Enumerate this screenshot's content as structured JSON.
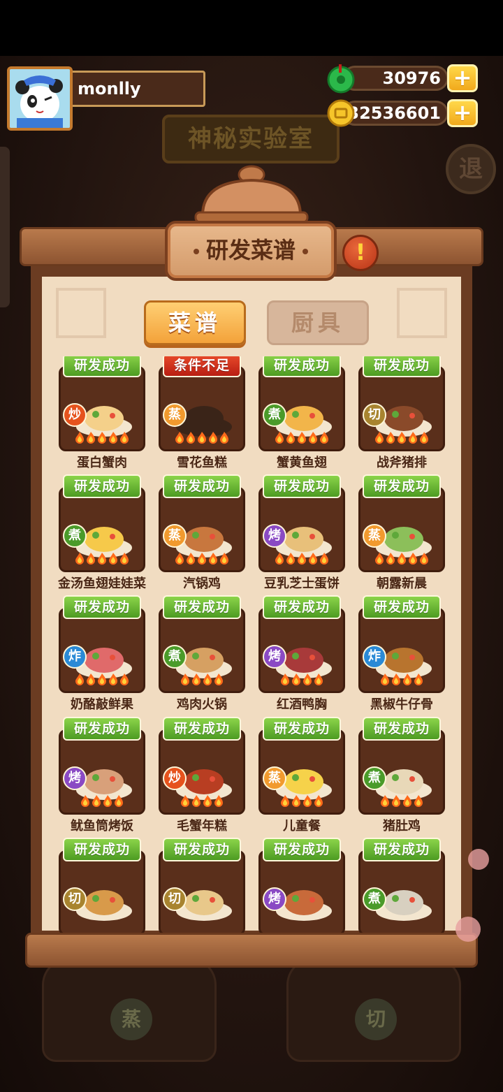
{
  "player": {
    "name": "monlly",
    "jade": "30976",
    "coins": "32536601",
    "plus": "+"
  },
  "background": {
    "lab_title": "神秘实验室",
    "exit_label": "退",
    "stove_left_label": "蒸",
    "stove_right_label": "切"
  },
  "panel": {
    "title": "研发菜谱",
    "warn_label": "!",
    "tabs": [
      {
        "label": "菜谱",
        "active": true
      },
      {
        "label": "厨具",
        "active": false
      }
    ]
  },
  "recipes": [
    {
      "name": "蛋白蟹肉",
      "status": "研发成功",
      "ok": true,
      "method": "炒",
      "flames": 5,
      "dish_color": "#f4d08a"
    },
    {
      "name": "雪花鱼糕",
      "status": "条件不足",
      "ok": false,
      "method": "蒸",
      "flames": 5,
      "dish_color": "#3a2418"
    },
    {
      "name": "蟹黄鱼翅",
      "status": "研发成功",
      "ok": true,
      "method": "煮",
      "flames": 5,
      "dish_color": "#f2b54a"
    },
    {
      "name": "战斧猪排",
      "status": "研发成功",
      "ok": true,
      "method": "切",
      "flames": 5,
      "dish_color": "#8a4a2a"
    },
    {
      "name": "金汤鱼翅娃娃菜",
      "status": "研发成功",
      "ok": true,
      "method": "煮",
      "flames": 5,
      "dish_color": "#f6c94a"
    },
    {
      "name": "汽锅鸡",
      "status": "研发成功",
      "ok": true,
      "method": "蒸",
      "flames": 5,
      "dish_color": "#c8773e"
    },
    {
      "name": "豆乳芝士蛋饼",
      "status": "研发成功",
      "ok": true,
      "method": "烤",
      "flames": 5,
      "dish_color": "#e8c07a"
    },
    {
      "name": "朝露新晨",
      "status": "研发成功",
      "ok": true,
      "method": "蒸",
      "flames": 5,
      "dish_color": "#8cbf5a"
    },
    {
      "name": "奶酪敲鲜果",
      "status": "研发成功",
      "ok": true,
      "method": "炸",
      "flames": 5,
      "dish_color": "#e06a6a"
    },
    {
      "name": "鸡肉火锅",
      "status": "研发成功",
      "ok": true,
      "method": "煮",
      "flames": 4,
      "dish_color": "#d6a062"
    },
    {
      "name": "红酒鸭胸",
      "status": "研发成功",
      "ok": true,
      "method": "烤",
      "flames": 4,
      "dish_color": "#a83a3a"
    },
    {
      "name": "黑椒牛仔骨",
      "status": "研发成功",
      "ok": true,
      "method": "炸",
      "flames": 4,
      "dish_color": "#b8742e"
    },
    {
      "name": "鱿鱼筒烤饭",
      "status": "研发成功",
      "ok": true,
      "method": "烤",
      "flames": 4,
      "dish_color": "#d8a07a"
    },
    {
      "name": "毛蟹年糕",
      "status": "研发成功",
      "ok": true,
      "method": "炒",
      "flames": 4,
      "dish_color": "#b83e22"
    },
    {
      "name": "儿童餐",
      "status": "研发成功",
      "ok": true,
      "method": "蒸",
      "flames": 4,
      "dish_color": "#f6d24a"
    },
    {
      "name": "猪肚鸡",
      "status": "研发成功",
      "ok": true,
      "method": "煮",
      "flames": 4,
      "dish_color": "#e8d8b8"
    },
    {
      "name": "",
      "status": "研发成功",
      "ok": true,
      "method": "切",
      "flames": 0,
      "dish_color": "#d89a4a"
    },
    {
      "name": "",
      "status": "研发成功",
      "ok": true,
      "method": "切",
      "flames": 0,
      "dish_color": "#e8c88a"
    },
    {
      "name": "",
      "status": "研发成功",
      "ok": true,
      "method": "烤",
      "flames": 0,
      "dish_color": "#c86a3a"
    },
    {
      "name": "",
      "status": "研发成功",
      "ok": true,
      "method": "煮",
      "flames": 0,
      "dish_color": "#d8d0c0"
    }
  ],
  "colors": {
    "ok_ribbon": "#5fae2c",
    "bad_ribbon": "#d0301a",
    "panel_paper": "#f1dcc1",
    "card_bg": "#5a2f1b"
  }
}
